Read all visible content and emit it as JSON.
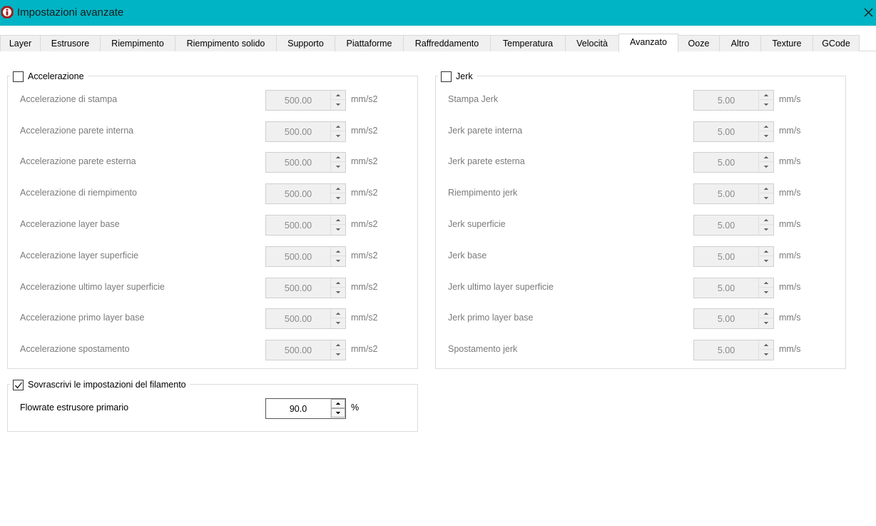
{
  "window": {
    "title": "Impostazioni avanzate",
    "accent_color": "#00b4c5",
    "icon": "app-logo-icon",
    "close_icon": "close-icon"
  },
  "tabs": [
    {
      "label": "Layer",
      "active": false
    },
    {
      "label": "Estrusore",
      "active": false
    },
    {
      "label": "Riempimento",
      "active": false
    },
    {
      "label": "Riempimento solido",
      "active": false
    },
    {
      "label": "Supporto",
      "active": false
    },
    {
      "label": "Piattaforme",
      "active": false
    },
    {
      "label": "Raffreddamento",
      "active": false
    },
    {
      "label": "Temperatura",
      "active": false
    },
    {
      "label": "Velocità",
      "active": false
    },
    {
      "label": "Avanzato",
      "active": true
    },
    {
      "label": "Ooze",
      "active": false
    },
    {
      "label": "Altro",
      "active": false
    },
    {
      "label": "Texture",
      "active": false
    },
    {
      "label": "GCode",
      "active": false
    }
  ],
  "acceleration": {
    "label": "Accelerazione",
    "checked": false,
    "rows": [
      {
        "label": "Accelerazione di stampa",
        "value": "500.00",
        "unit": "mm/s2"
      },
      {
        "label": "Accelerazione parete interna",
        "value": "500.00",
        "unit": "mm/s2"
      },
      {
        "label": "Accelerazione parete esterna",
        "value": "500.00",
        "unit": "mm/s2"
      },
      {
        "label": "Accelerazione di riempimento",
        "value": "500.00",
        "unit": "mm/s2"
      },
      {
        "label": "Accelerazione layer base",
        "value": "500.00",
        "unit": "mm/s2"
      },
      {
        "label": "Accelerazione layer superficie",
        "value": "500.00",
        "unit": "mm/s2"
      },
      {
        "label": "Accelerazione ultimo layer superficie",
        "value": "500.00",
        "unit": "mm/s2"
      },
      {
        "label": "Accelerazione primo layer base",
        "value": "500.00",
        "unit": "mm/s2"
      },
      {
        "label": "Accelerazione spostamento",
        "value": "500.00",
        "unit": "mm/s2"
      }
    ]
  },
  "jerk": {
    "label": "Jerk",
    "checked": false,
    "rows": [
      {
        "label": "Stampa Jerk",
        "value": "5.00",
        "unit": "mm/s"
      },
      {
        "label": "Jerk parete interna",
        "value": "5.00",
        "unit": "mm/s"
      },
      {
        "label": "Jerk parete esterna",
        "value": "5.00",
        "unit": "mm/s"
      },
      {
        "label": "Riempimento jerk",
        "value": "5.00",
        "unit": "mm/s"
      },
      {
        "label": "Jerk superficie",
        "value": "5.00",
        "unit": "mm/s"
      },
      {
        "label": "Jerk base",
        "value": "5.00",
        "unit": "mm/s"
      },
      {
        "label": "Jerk ultimo layer superficie",
        "value": "5.00",
        "unit": "mm/s"
      },
      {
        "label": "Jerk primo layer base",
        "value": "5.00",
        "unit": "mm/s"
      },
      {
        "label": "Spostamento jerk",
        "value": "5.00",
        "unit": "mm/s"
      }
    ]
  },
  "filament_override": {
    "label": "Sovrascrivi le impostazioni del filamento",
    "checked": true,
    "rows": [
      {
        "label": "Flowrate estrusore primario",
        "value": "90.0",
        "unit": "%"
      }
    ]
  }
}
